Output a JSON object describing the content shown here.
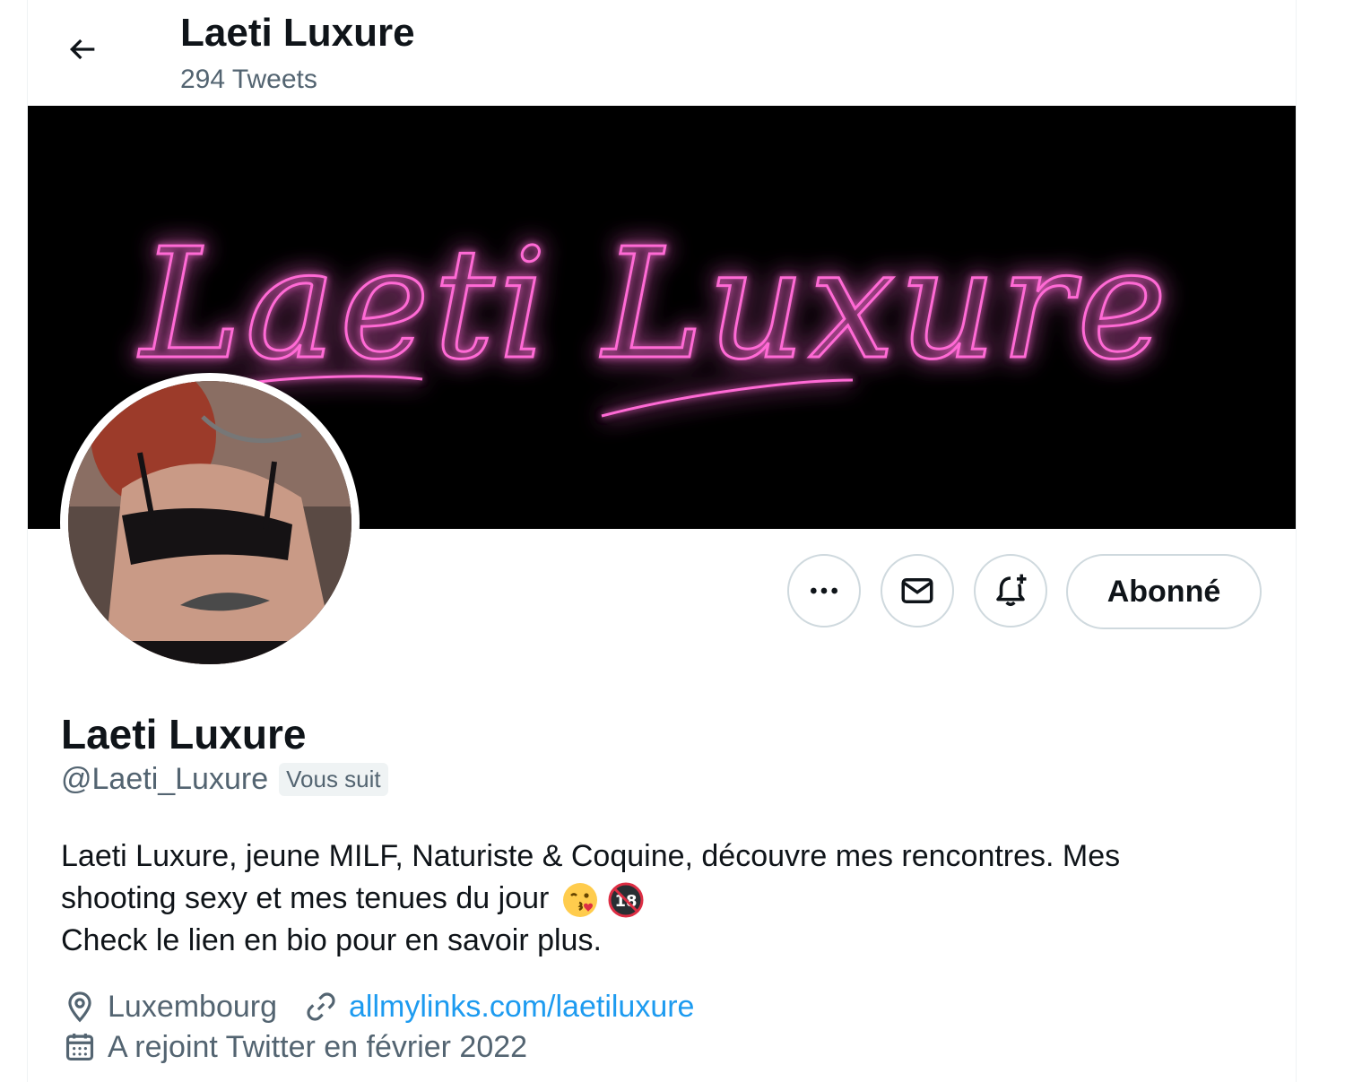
{
  "header": {
    "title": "Laeti Luxure",
    "tweet_count": "294 Tweets"
  },
  "banner": {
    "neon_text": "Laeti Luxure",
    "neon_color": "#e040a8"
  },
  "actions": {
    "more_label": "•••",
    "follow_label": "Abonné"
  },
  "profile": {
    "display_name": "Laeti Luxure",
    "handle": "@Laeti_Luxure",
    "follows_you": "Vous suit",
    "bio_line1": "Laeti Luxure, jeune MILF, Naturiste & Coquine, découvre mes rencontres. Mes",
    "bio_line2": "shooting sexy et mes tenues du jour",
    "bio_line3": "Check le lien en bio pour en savoir plus.",
    "location": "Luxembourg",
    "link": "allmylinks.com/laetiluxure",
    "joined": "A rejoint Twitter en février 2022"
  },
  "icons": {
    "back": "arrow-left-icon",
    "more": "more-icon",
    "message": "mail-icon",
    "notify": "bell-plus-icon",
    "location": "location-pin-icon",
    "link": "link-icon",
    "calendar": "calendar-icon",
    "kiss_emoji": "kissing-face-emoji",
    "no18_emoji": "no-under-18-emoji"
  },
  "colors": {
    "accent": "#1d9bf0",
    "muted": "#536471",
    "text": "#0f1419",
    "border": "#cfd9de"
  }
}
